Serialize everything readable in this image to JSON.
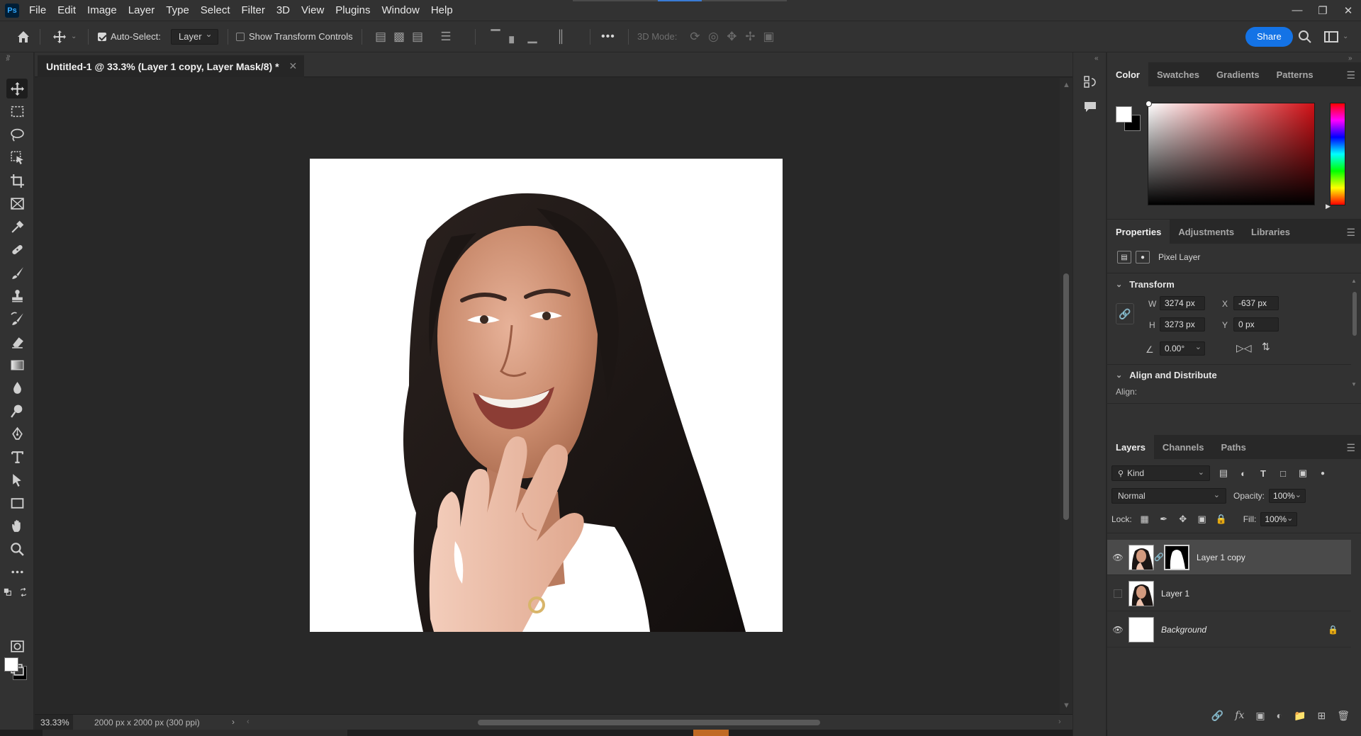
{
  "app": {
    "logo": "Ps",
    "menu": [
      "File",
      "Edit",
      "Image",
      "Layer",
      "Type",
      "Select",
      "Filter",
      "3D",
      "View",
      "Plugins",
      "Window",
      "Help"
    ],
    "window_controls": [
      "minimize-icon",
      "restore-icon",
      "close-icon"
    ]
  },
  "options_bar": {
    "auto_select_label": "Auto-Select:",
    "auto_select_checked": true,
    "auto_select_target": "Layer",
    "show_transform_label": "Show Transform Controls",
    "show_transform_checked": false,
    "more_label": "•••",
    "mode_3d_label": "3D Mode:",
    "share_label": "Share"
  },
  "document": {
    "tab_title": "Untitled-1 @ 33.3% (Layer 1 copy, Layer Mask/8) *",
    "zoom": "33.33%",
    "size_info": "2000 px x 2000 px (300 ppi)",
    "canvas_background": "#ffffff"
  },
  "color_panel": {
    "tabs": [
      "Color",
      "Swatches",
      "Gradients",
      "Patterns"
    ],
    "active_tab": "Color",
    "foreground": "#ffffff",
    "background": "#000000",
    "hue_color": "#d11016"
  },
  "properties_panel": {
    "tabs": [
      "Properties",
      "Adjustments",
      "Libraries"
    ],
    "active_tab": "Properties",
    "kind": "Pixel Layer",
    "transform_title": "Transform",
    "w_label": "W",
    "w_value": "3274 px",
    "h_label": "H",
    "h_value": "3273 px",
    "x_label": "X",
    "x_value": "-637 px",
    "y_label": "Y",
    "y_value": "0 px",
    "angle_value": "0.00°",
    "align_title": "Align and Distribute",
    "align_label": "Align:"
  },
  "layers_panel": {
    "tabs": [
      "Layers",
      "Channels",
      "Paths"
    ],
    "active_tab": "Layers",
    "kind_filter": "Kind",
    "blend_mode": "Normal",
    "opacity_label": "Opacity:",
    "opacity_value": "100%",
    "lock_label": "Lock:",
    "fill_label": "Fill:",
    "fill_value": "100%",
    "layers": [
      {
        "name": "Layer 1 copy",
        "visible": true,
        "selected": true,
        "has_mask": true
      },
      {
        "name": "Layer 1",
        "visible": false,
        "selected": false,
        "has_mask": false
      },
      {
        "name": "Background",
        "visible": true,
        "selected": false,
        "has_mask": false,
        "locked": true
      }
    ]
  },
  "colors": {
    "accent": "#1473e6",
    "chrome": "#323232",
    "workspace": "#282828"
  }
}
